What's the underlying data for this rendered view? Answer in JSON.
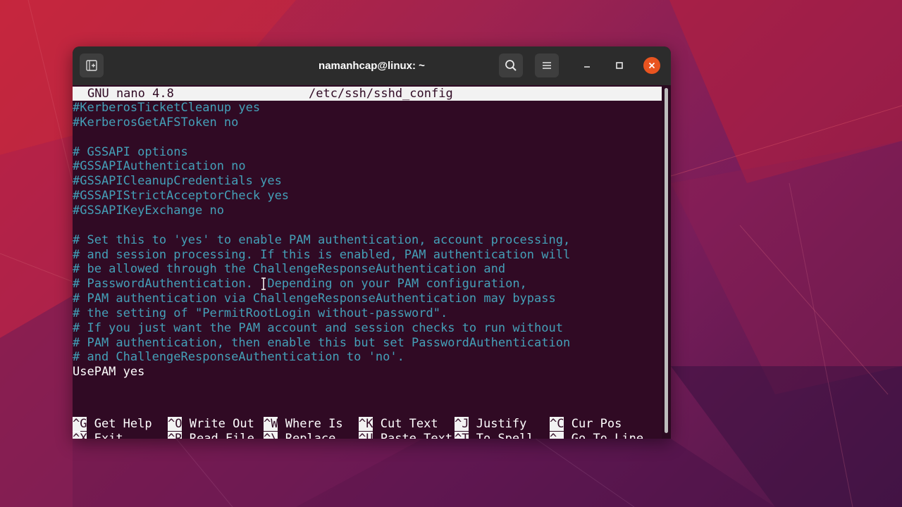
{
  "window": {
    "title": "namanhcap@linux: ~"
  },
  "nano": {
    "version_label": "GNU nano 4.8",
    "file_path": "/etc/ssh/sshd_config",
    "lines": [
      {
        "text": "#KerberosTicketCleanup yes",
        "style": "comment"
      },
      {
        "text": "#KerberosGetAFSToken no",
        "style": "comment"
      },
      {
        "text": "",
        "style": "comment"
      },
      {
        "text": "# GSSAPI options",
        "style": "comment"
      },
      {
        "text": "#GSSAPIAuthentication no",
        "style": "comment"
      },
      {
        "text": "#GSSAPICleanupCredentials yes",
        "style": "comment"
      },
      {
        "text": "#GSSAPIStrictAcceptorCheck yes",
        "style": "comment"
      },
      {
        "text": "#GSSAPIKeyExchange no",
        "style": "comment"
      },
      {
        "text": "",
        "style": "comment"
      },
      {
        "text": "# Set this to 'yes' to enable PAM authentication, account processing,",
        "style": "comment"
      },
      {
        "text": "# and session processing. If this is enabled, PAM authentication will",
        "style": "comment"
      },
      {
        "text": "# be allowed through the ChallengeResponseAuthentication and",
        "style": "comment"
      },
      {
        "text": "# PasswordAuthentication.  Depending on your PAM configuration,",
        "style": "comment"
      },
      {
        "text": "# PAM authentication via ChallengeResponseAuthentication may bypass",
        "style": "comment"
      },
      {
        "text": "# the setting of \"PermitRootLogin without-password\".",
        "style": "comment"
      },
      {
        "text": "# If you just want the PAM account and session checks to run without",
        "style": "comment"
      },
      {
        "text": "# PAM authentication, then enable this but set PasswordAuthentication",
        "style": "comment"
      },
      {
        "text": "# and ChallengeResponseAuthentication to 'no'.",
        "style": "comment"
      },
      {
        "text": "UsePAM yes",
        "style": "plain"
      }
    ],
    "shortcuts": [
      {
        "key": "^G",
        "label": "Get Help"
      },
      {
        "key": "^O",
        "label": "Write Out"
      },
      {
        "key": "^W",
        "label": "Where Is"
      },
      {
        "key": "^K",
        "label": "Cut Text"
      },
      {
        "key": "^J",
        "label": "Justify"
      },
      {
        "key": "^C",
        "label": "Cur Pos"
      },
      {
        "key": "^X",
        "label": "Exit"
      },
      {
        "key": "^R",
        "label": "Read File"
      },
      {
        "key": "^\\",
        "label": "Replace"
      },
      {
        "key": "^U",
        "label": "Paste Text"
      },
      {
        "key": "^T",
        "label": "To Spell"
      },
      {
        "key": "^_",
        "label": "Go To Line"
      }
    ]
  },
  "colors": {
    "terminal_bg": "#300a24",
    "comment": "#44a0b8",
    "close_button": "#e95420",
    "titlebar": "#2c2c2c"
  },
  "icons": [
    "new-tab-icon",
    "search-icon",
    "hamburger-menu-icon",
    "minimize-icon",
    "maximize-icon",
    "close-icon",
    "text-cursor-icon"
  ]
}
